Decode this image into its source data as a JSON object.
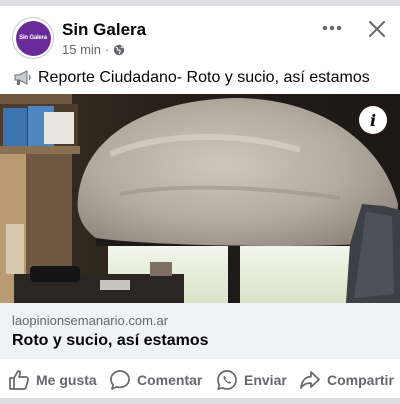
{
  "post": {
    "page_name": "Sin Galera",
    "avatar_logo": "Sin Galera",
    "time": "15 min",
    "separator": "·",
    "text": "Reporte Ciudadano- Roto y sucio, así estamos"
  },
  "link_preview": {
    "domain": "laopinionsemanario.com.ar",
    "title": "Roto y sucio, así estamos"
  },
  "actions": {
    "like": "Me gusta",
    "comment": "Comentar",
    "send": "Enviar",
    "share": "Compartir"
  },
  "info_glyph": "i",
  "colors": {
    "text_primary": "#050505",
    "text_secondary": "#65676b",
    "link_bg": "#f0f2f5",
    "avatar_brand": "#6a2b9a"
  },
  "icons": [
    "globe-icon",
    "more-icon",
    "close-icon",
    "megaphone-icon",
    "info-icon",
    "like-icon",
    "comment-icon",
    "whatsapp-icon",
    "share-icon"
  ]
}
